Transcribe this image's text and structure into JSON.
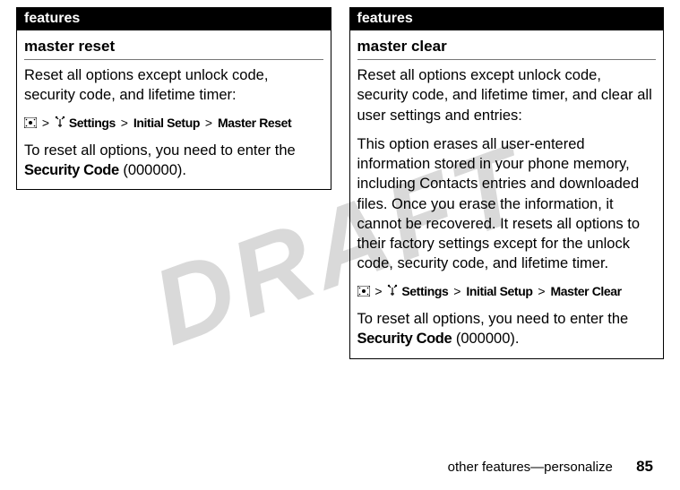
{
  "watermark": "DRAFT",
  "left": {
    "header": "features",
    "title": "master reset",
    "para1": "Reset all options except unlock code, security code, and lifetime timer:",
    "nav": {
      "settings": "Settings",
      "gt1": ">",
      "initial_setup": "Initial Setup",
      "gt2": ">",
      "action": "Master Reset"
    },
    "note_prefix": "To reset all options, you need to enter the ",
    "security_code": "Security Code",
    "code_value": " (000000)."
  },
  "right": {
    "header": "features",
    "title": "master clear",
    "para1": "Reset all options except unlock code, security code, and lifetime timer, and clear all user settings and entries:",
    "para2": "This option erases all user-entered information stored in your phone memory, including Contacts entries and downloaded files. Once you erase the information, it cannot be recovered. It resets all options to their factory settings except for the unlock code, security code, and lifetime timer.",
    "nav": {
      "settings": "Settings",
      "gt1": ">",
      "initial_setup": "Initial Setup",
      "gt2": ">",
      "action": "Master Clear"
    },
    "note_prefix": "To reset all options, you need to enter the ",
    "security_code": "Security Code",
    "code_value": " (000000)."
  },
  "footer": {
    "section": "other features—personalize",
    "page": "85"
  }
}
